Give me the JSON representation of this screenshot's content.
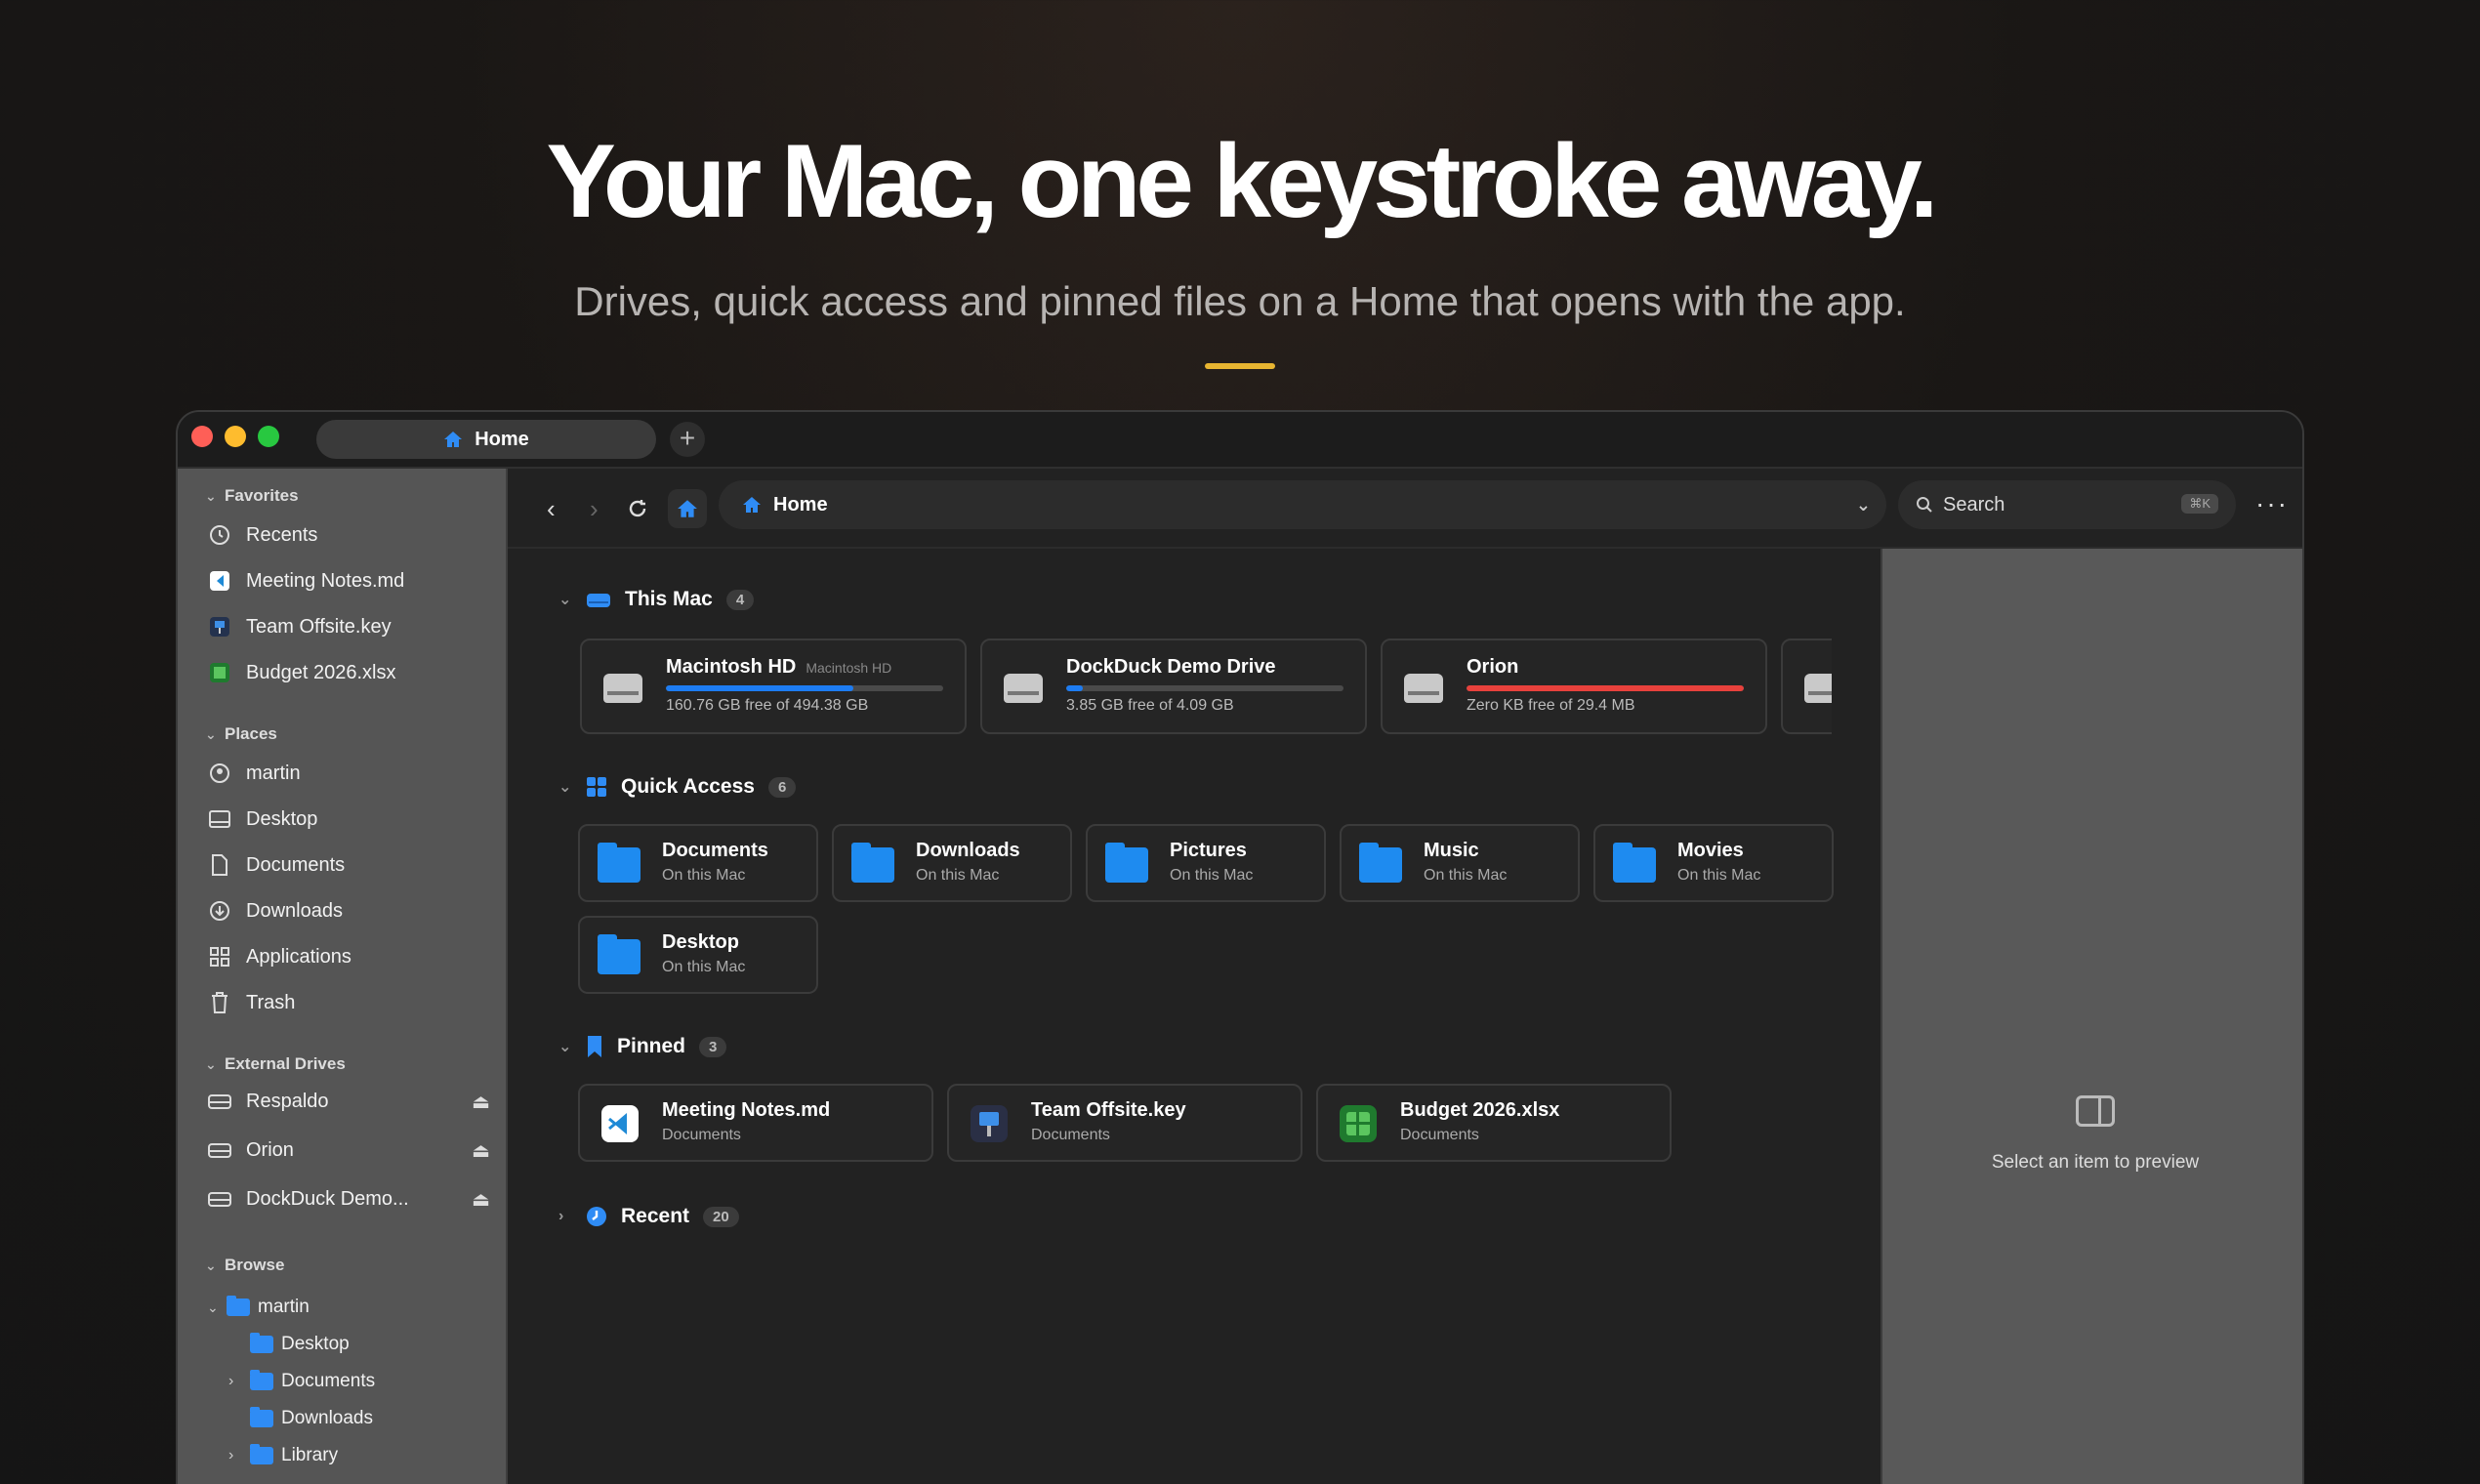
{
  "hero": {
    "title": "Your Mac, one keystroke away.",
    "subtitle": "Drives, quick access and pinned files on a Home that opens with the app."
  },
  "window": {
    "tab_label": "Home",
    "new_tab_label": "+"
  },
  "sidebar": {
    "favorites_header": "Favorites",
    "favorites": [
      {
        "label": "Recents",
        "icon": "clock-icon"
      },
      {
        "label": "Meeting Notes.md",
        "icon": "vscode-icon"
      },
      {
        "label": "Team Offsite.key",
        "icon": "keynote-icon"
      },
      {
        "label": "Budget 2026.xlsx",
        "icon": "spreadsheet-icon"
      }
    ],
    "places_header": "Places",
    "places": [
      {
        "label": "martin",
        "icon": "user-icon"
      },
      {
        "label": "Desktop",
        "icon": "desktop-icon"
      },
      {
        "label": "Documents",
        "icon": "document-icon"
      },
      {
        "label": "Downloads",
        "icon": "download-icon"
      },
      {
        "label": "Applications",
        "icon": "grid-icon"
      },
      {
        "label": "Trash",
        "icon": "trash-icon"
      }
    ],
    "external_header": "External Drives",
    "external": [
      {
        "label": "Respaldo"
      },
      {
        "label": "Orion"
      },
      {
        "label": "DockDuck Demo..."
      }
    ],
    "browse_header": "Browse",
    "browse_root": "martin",
    "browse_children": [
      "Desktop",
      "Documents",
      "Downloads",
      "Library"
    ]
  },
  "toolbar": {
    "path_label": "Home",
    "search_placeholder": "Search",
    "search_shortcut": "⌘K"
  },
  "sections": {
    "this_mac": {
      "title": "This Mac",
      "count": "4"
    },
    "quick_access": {
      "title": "Quick Access",
      "count": "6"
    },
    "pinned": {
      "title": "Pinned",
      "count": "3"
    },
    "recent": {
      "title": "Recent",
      "count": "20"
    }
  },
  "drives": [
    {
      "name": "Macintosh HD",
      "volume": "Macintosh HD",
      "info": "160.76 GB free of 494.38 GB",
      "used_fraction": 0.675,
      "color": "#1d7cf2"
    },
    {
      "name": "DockDuck Demo Drive",
      "volume": "",
      "info": "3.85 GB free of 4.09 GB",
      "used_fraction": 0.06,
      "color": "#1d7cf2"
    },
    {
      "name": "Orion",
      "volume": "",
      "info": "Zero KB free of 29.4 MB",
      "used_fraction": 1.0,
      "color": "#e8413c"
    }
  ],
  "quick_access": [
    {
      "name": "Documents",
      "location": "On this Mac"
    },
    {
      "name": "Downloads",
      "location": "On this Mac"
    },
    {
      "name": "Pictures",
      "location": "On this Mac"
    },
    {
      "name": "Music",
      "location": "On this Mac"
    },
    {
      "name": "Movies",
      "location": "On this Mac"
    },
    {
      "name": "Desktop",
      "location": "On this Mac"
    }
  ],
  "pinned": [
    {
      "name": "Meeting Notes.md",
      "location": "Documents",
      "icon": "vscode-icon",
      "color": "#ffffff"
    },
    {
      "name": "Team Offsite.key",
      "location": "Documents",
      "icon": "keynote-icon",
      "color": "#2a2f45"
    },
    {
      "name": "Budget 2026.xlsx",
      "location": "Documents",
      "icon": "spreadsheet-icon",
      "color": "#1f7a2e"
    }
  ],
  "preview": {
    "empty_text": "Select an item to preview"
  },
  "colors": {
    "accent": "#1e8bf0",
    "hero_bar": "#e8b531",
    "danger": "#e8413c"
  }
}
